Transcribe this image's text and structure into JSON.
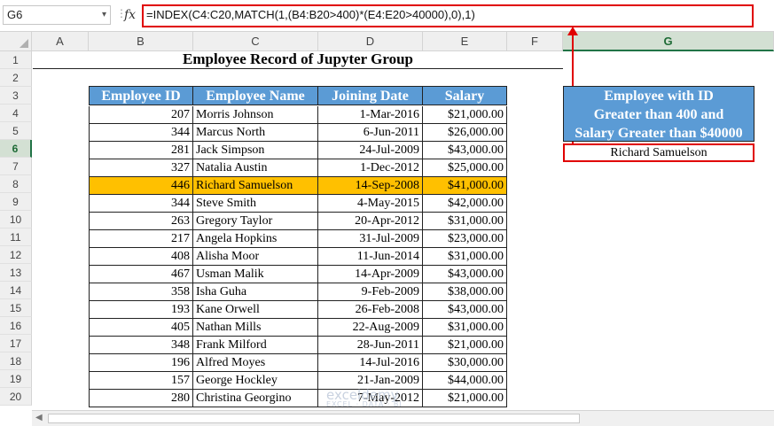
{
  "formula_bar": {
    "name_box": "G6",
    "fx": "fx",
    "formula": "=INDEX(C4:C20,MATCH(1,(B4:B20>400)*(E4:E20>40000),0),1)"
  },
  "columns": [
    "A",
    "B",
    "C",
    "D",
    "E",
    "F",
    "G"
  ],
  "selected_column": "G",
  "rows": [
    "1",
    "2",
    "3",
    "4",
    "5",
    "6",
    "7",
    "8",
    "9",
    "10",
    "11",
    "12",
    "13",
    "14",
    "15",
    "16",
    "17",
    "18",
    "19",
    "20"
  ],
  "selected_row": "6",
  "title": "Employee Record of Jupyter Group",
  "table": {
    "headers": [
      "Employee ID",
      "Employee Name",
      "Joining Date",
      "Salary"
    ],
    "highlight_row": 4,
    "highlight_color": "#ffc000",
    "header_color": "#5b9bd5",
    "rows": [
      [
        "207",
        "Morris Johnson",
        "1-Mar-2016",
        "$21,000.00"
      ],
      [
        "344",
        "Marcus North",
        "6-Jun-2011",
        "$26,000.00"
      ],
      [
        "281",
        "Jack Simpson",
        "24-Jul-2009",
        "$43,000.00"
      ],
      [
        "327",
        "Natalia Austin",
        "1-Dec-2012",
        "$25,000.00"
      ],
      [
        "446",
        "Richard Samuelson",
        "14-Sep-2008",
        "$41,000.00"
      ],
      [
        "344",
        "Steve Smith",
        "4-May-2015",
        "$42,000.00"
      ],
      [
        "263",
        "Gregory Taylor",
        "20-Apr-2012",
        "$31,000.00"
      ],
      [
        "217",
        "Angela Hopkins",
        "31-Jul-2009",
        "$23,000.00"
      ],
      [
        "408",
        "Alisha Moor",
        "11-Jun-2014",
        "$31,000.00"
      ],
      [
        "467",
        "Usman Malik",
        "14-Apr-2009",
        "$43,000.00"
      ],
      [
        "358",
        "Isha Guha",
        "9-Feb-2009",
        "$38,000.00"
      ],
      [
        "193",
        "Kane Orwell",
        "26-Feb-2008",
        "$43,000.00"
      ],
      [
        "405",
        "Nathan Mills",
        "22-Aug-2009",
        "$31,000.00"
      ],
      [
        "348",
        "Frank Milford",
        "28-Jun-2011",
        "$21,000.00"
      ],
      [
        "196",
        "Alfred Moyes",
        "14-Jul-2016",
        "$30,000.00"
      ],
      [
        "157",
        "George Hockley",
        "21-Jan-2009",
        "$44,000.00"
      ],
      [
        "280",
        "Christina Georgino",
        "7-May-2012",
        "$21,000.00"
      ]
    ]
  },
  "result_box": {
    "lines": [
      "Employee with ID",
      "Greater than 400 and",
      "Salary Greater than $40000"
    ],
    "value": "Richard Samuelson"
  },
  "watermark": {
    "main": "exceldemy",
    "sub": "EXCEL · DATA · BI"
  },
  "accent_color": "#e00000"
}
